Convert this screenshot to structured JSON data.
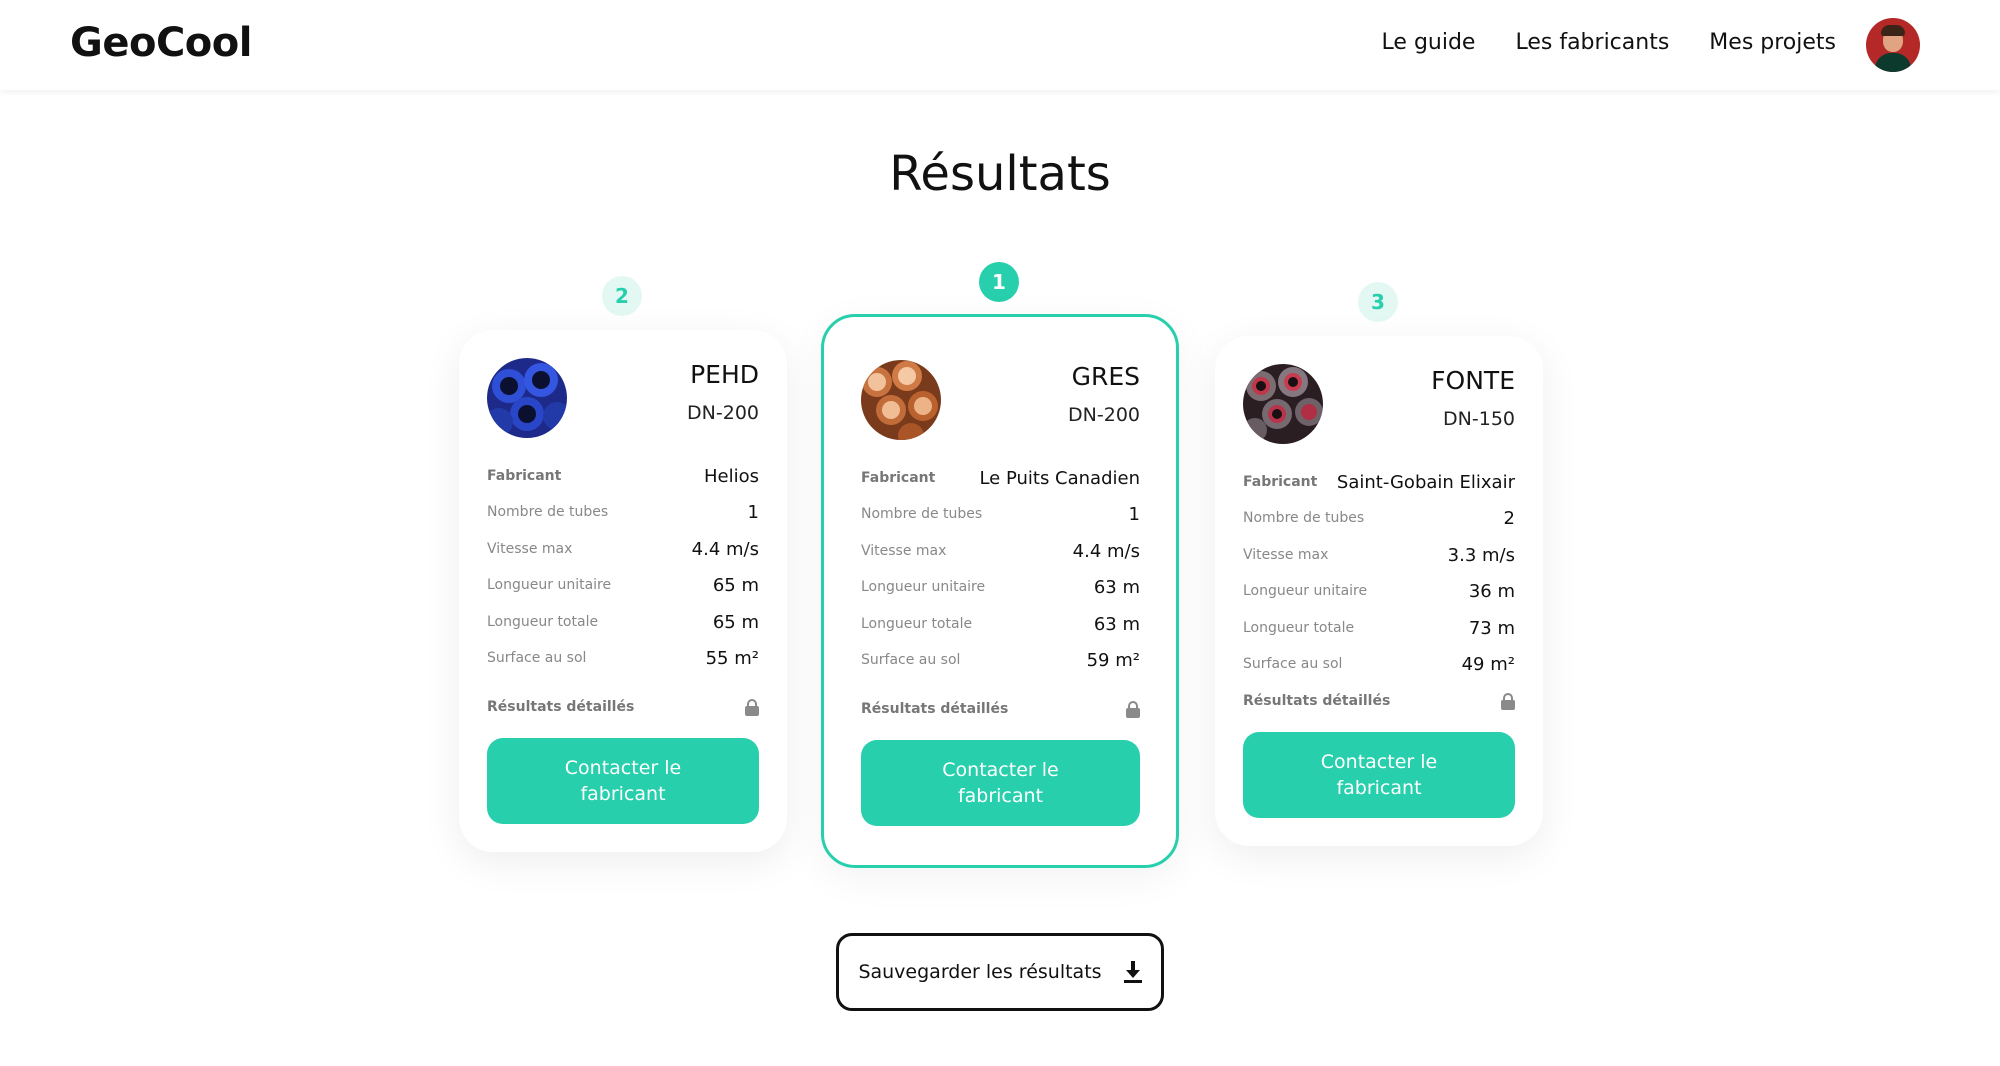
{
  "header": {
    "logo": "GeoCool",
    "nav": [
      "Le guide",
      "Les fabricants",
      "Mes projets"
    ]
  },
  "page_title": "Résultats",
  "labels": {
    "manufacturer": "Fabricant",
    "tubes": "Nombre de tubes",
    "speed": "Vitesse max",
    "unit_length": "Longueur unitaire",
    "total_length": "Longueur totale",
    "ground_area": "Surface au sol",
    "detailed": "Résultats détaillés",
    "contact": "Contacter le fabricant"
  },
  "results": [
    {
      "rank": "2",
      "material": "PEHD",
      "dn": "DN-200",
      "manufacturer": "Helios",
      "tubes": "1",
      "speed": "4.4 m/s",
      "unit_length": "65 m",
      "total_length": "65 m",
      "ground_area": "55 m²",
      "image": "blue-pipes-image"
    },
    {
      "rank": "1",
      "material": "GRES",
      "dn": "DN-200",
      "manufacturer": "Le Puits Canadien",
      "tubes": "1",
      "speed": "4.4 m/s",
      "unit_length": "63 m",
      "total_length": "63 m",
      "ground_area": "59 m²",
      "image": "terracotta-pipes-image"
    },
    {
      "rank": "3",
      "material": "FONTE",
      "dn": "DN-150",
      "manufacturer": "Saint-Gobain Elixair",
      "tubes": "2",
      "speed": "3.3 m/s",
      "unit_length": "36 m",
      "total_length": "73 m",
      "ground_area": "49 m²",
      "image": "cast-iron-pipes-image"
    }
  ],
  "save_button": "Sauvegarder les résultats",
  "colors": {
    "accent": "#27cfac",
    "accent_light": "#e3f8f3",
    "avatar_bg": "#b52828"
  }
}
